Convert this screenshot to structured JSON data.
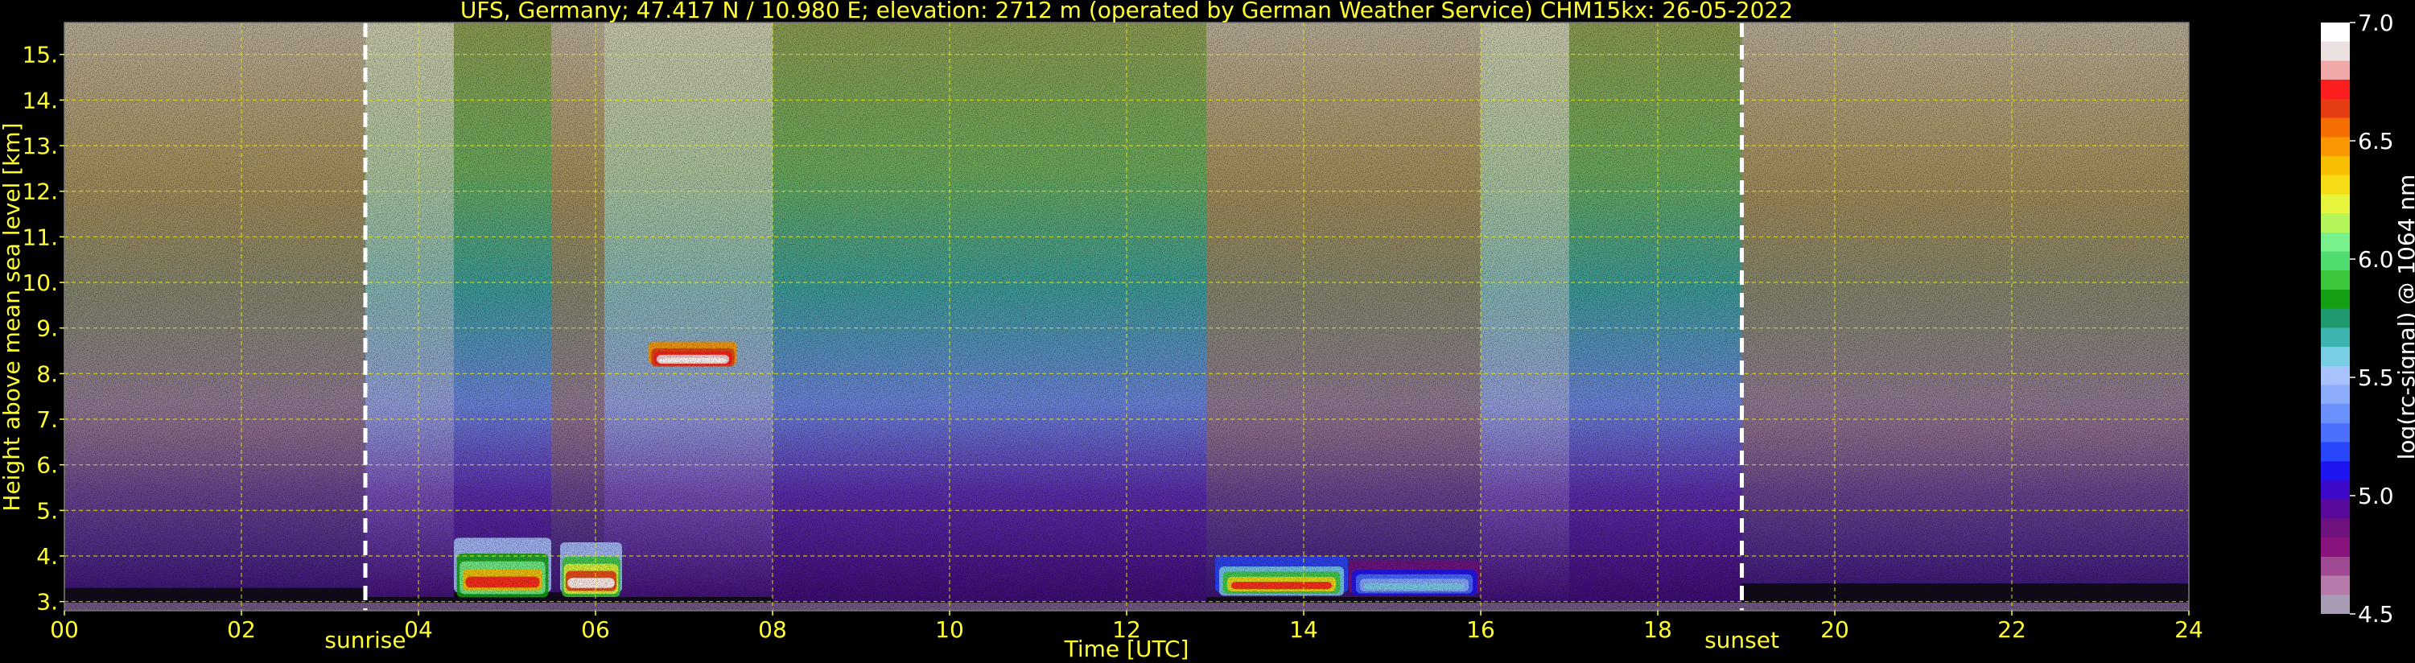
{
  "chart_data": {
    "type": "heatmap",
    "title": "UFS, Germany; 47.417 N / 10.980 E; elevation: 2712 m  (operated by German Weather Service)    CHM15kx: 26-05-2022",
    "xlabel": "Time [UTC]",
    "ylabel": "Height above mean sea level [km]",
    "xlim": [
      0,
      24
    ],
    "ylim": [
      2.8,
      15.7
    ],
    "xticks": [
      "00",
      "02",
      "04",
      "06",
      "08",
      "10",
      "12",
      "14",
      "16",
      "18",
      "20",
      "22",
      "24"
    ],
    "yticks": [
      "3.",
      "4.",
      "5.",
      "6.",
      "7.",
      "8.",
      "9.",
      "10.",
      "11.",
      "12.",
      "13.",
      "14.",
      "15."
    ],
    "grid": true,
    "markers": [
      {
        "label": "sunrise",
        "x": 3.4
      },
      {
        "label": "sunset",
        "x": 18.95
      }
    ],
    "colorbar": {
      "label": "log(rc-signal) @ 1064 nm",
      "range": [
        4.5,
        7.0
      ],
      "ticks": [
        "4.5",
        "5.0",
        "5.5",
        "6.0",
        "6.5",
        "7.0"
      ],
      "colors": [
        "#a89cb4",
        "#b67aa8",
        "#a04a94",
        "#8a147e",
        "#70127e",
        "#5a0a9a",
        "#3c0ac8",
        "#1e14f0",
        "#2a46fa",
        "#4a70fc",
        "#6a90fc",
        "#8cacfc",
        "#a8c2fc",
        "#7acee4",
        "#3cb4b0",
        "#1e9a6e",
        "#14a014",
        "#3cc83c",
        "#50dc6e",
        "#78f08c",
        "#b4f55a",
        "#e6f53c",
        "#f5dc14",
        "#fabe00",
        "#fa9600",
        "#f56e00",
        "#e63c14",
        "#fa1e1e",
        "#f0a8a8",
        "#ebe1e1",
        "#ffffff"
      ]
    },
    "time_segments": [
      {
        "x": [
          0,
          3.4
        ],
        "surface_top": 3.3
      },
      {
        "x": [
          3.4,
          4.4
        ],
        "surface_top": 3.1
      },
      {
        "x": [
          4.4,
          5.5
        ],
        "surface_top": 3.2
      },
      {
        "x": [
          5.5,
          6.1
        ],
        "surface_top": 3.2
      },
      {
        "x": [
          6.1,
          8.0
        ],
        "surface_top": 3.1
      },
      {
        "x": [
          8.0,
          12.9
        ],
        "surface_top": 3.0
      },
      {
        "x": [
          12.9,
          16.0
        ],
        "surface_top": 3.1
      },
      {
        "x": [
          16.0,
          17.0
        ],
        "surface_top": 3.0
      },
      {
        "x": [
          17.0,
          18.95
        ],
        "surface_top": 3.0
      },
      {
        "x": [
          18.95,
          24
        ],
        "surface_top": 3.4
      }
    ],
    "features": [
      {
        "name": "boundary-layer-aerosol",
        "x": [
          4.4,
          5.5
        ],
        "y": [
          3.2,
          4.4
        ],
        "value_range": [
          5.5,
          6.7
        ]
      },
      {
        "name": "boundary-layer-aerosol",
        "x": [
          5.6,
          6.3
        ],
        "y": [
          3.2,
          4.3
        ],
        "value_range": [
          5.5,
          7.0
        ]
      },
      {
        "name": "boundary-layer-aerosol",
        "x": [
          13.0,
          14.5
        ],
        "y": [
          3.2,
          4.0
        ],
        "value_range": [
          5.2,
          6.7
        ]
      },
      {
        "name": "boundary-layer-aerosol",
        "x": [
          14.5,
          16.0
        ],
        "y": [
          3.2,
          3.9
        ],
        "value_range": [
          4.9,
          5.6
        ]
      },
      {
        "name": "cloud-layer",
        "x": [
          6.6,
          7.6
        ],
        "y": [
          8.2,
          8.7
        ],
        "value_range": [
          6.5,
          7.0
        ]
      }
    ]
  }
}
